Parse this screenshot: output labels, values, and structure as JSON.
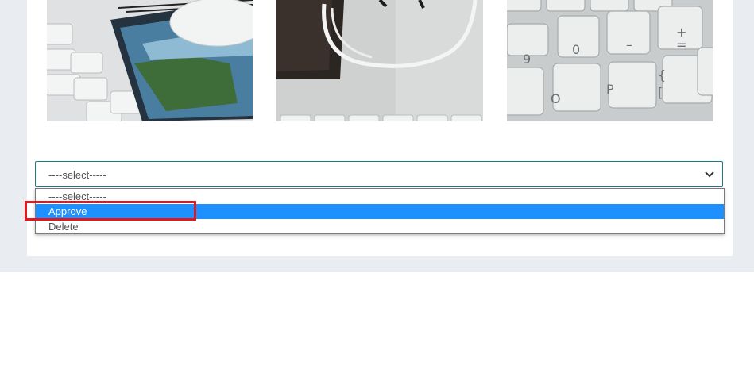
{
  "gallery": {
    "images": [
      {
        "name": "keyboard-mousepad-photo"
      },
      {
        "name": "wallet-cable-photo"
      },
      {
        "name": "keyboard-keys-photo"
      }
    ]
  },
  "action_select": {
    "current_value": "----select-----",
    "options": [
      "----select-----",
      "Approve",
      "Delete"
    ],
    "highlighted_option": "Approve"
  },
  "colors": {
    "page_background": "#e9edf2",
    "card_background": "#ffffff",
    "select_border": "#1f7a8c",
    "option_selected": "#1e90ff",
    "annotation_box": "#e0191e"
  },
  "icons": {
    "select_arrow": "chevron-down-icon"
  }
}
